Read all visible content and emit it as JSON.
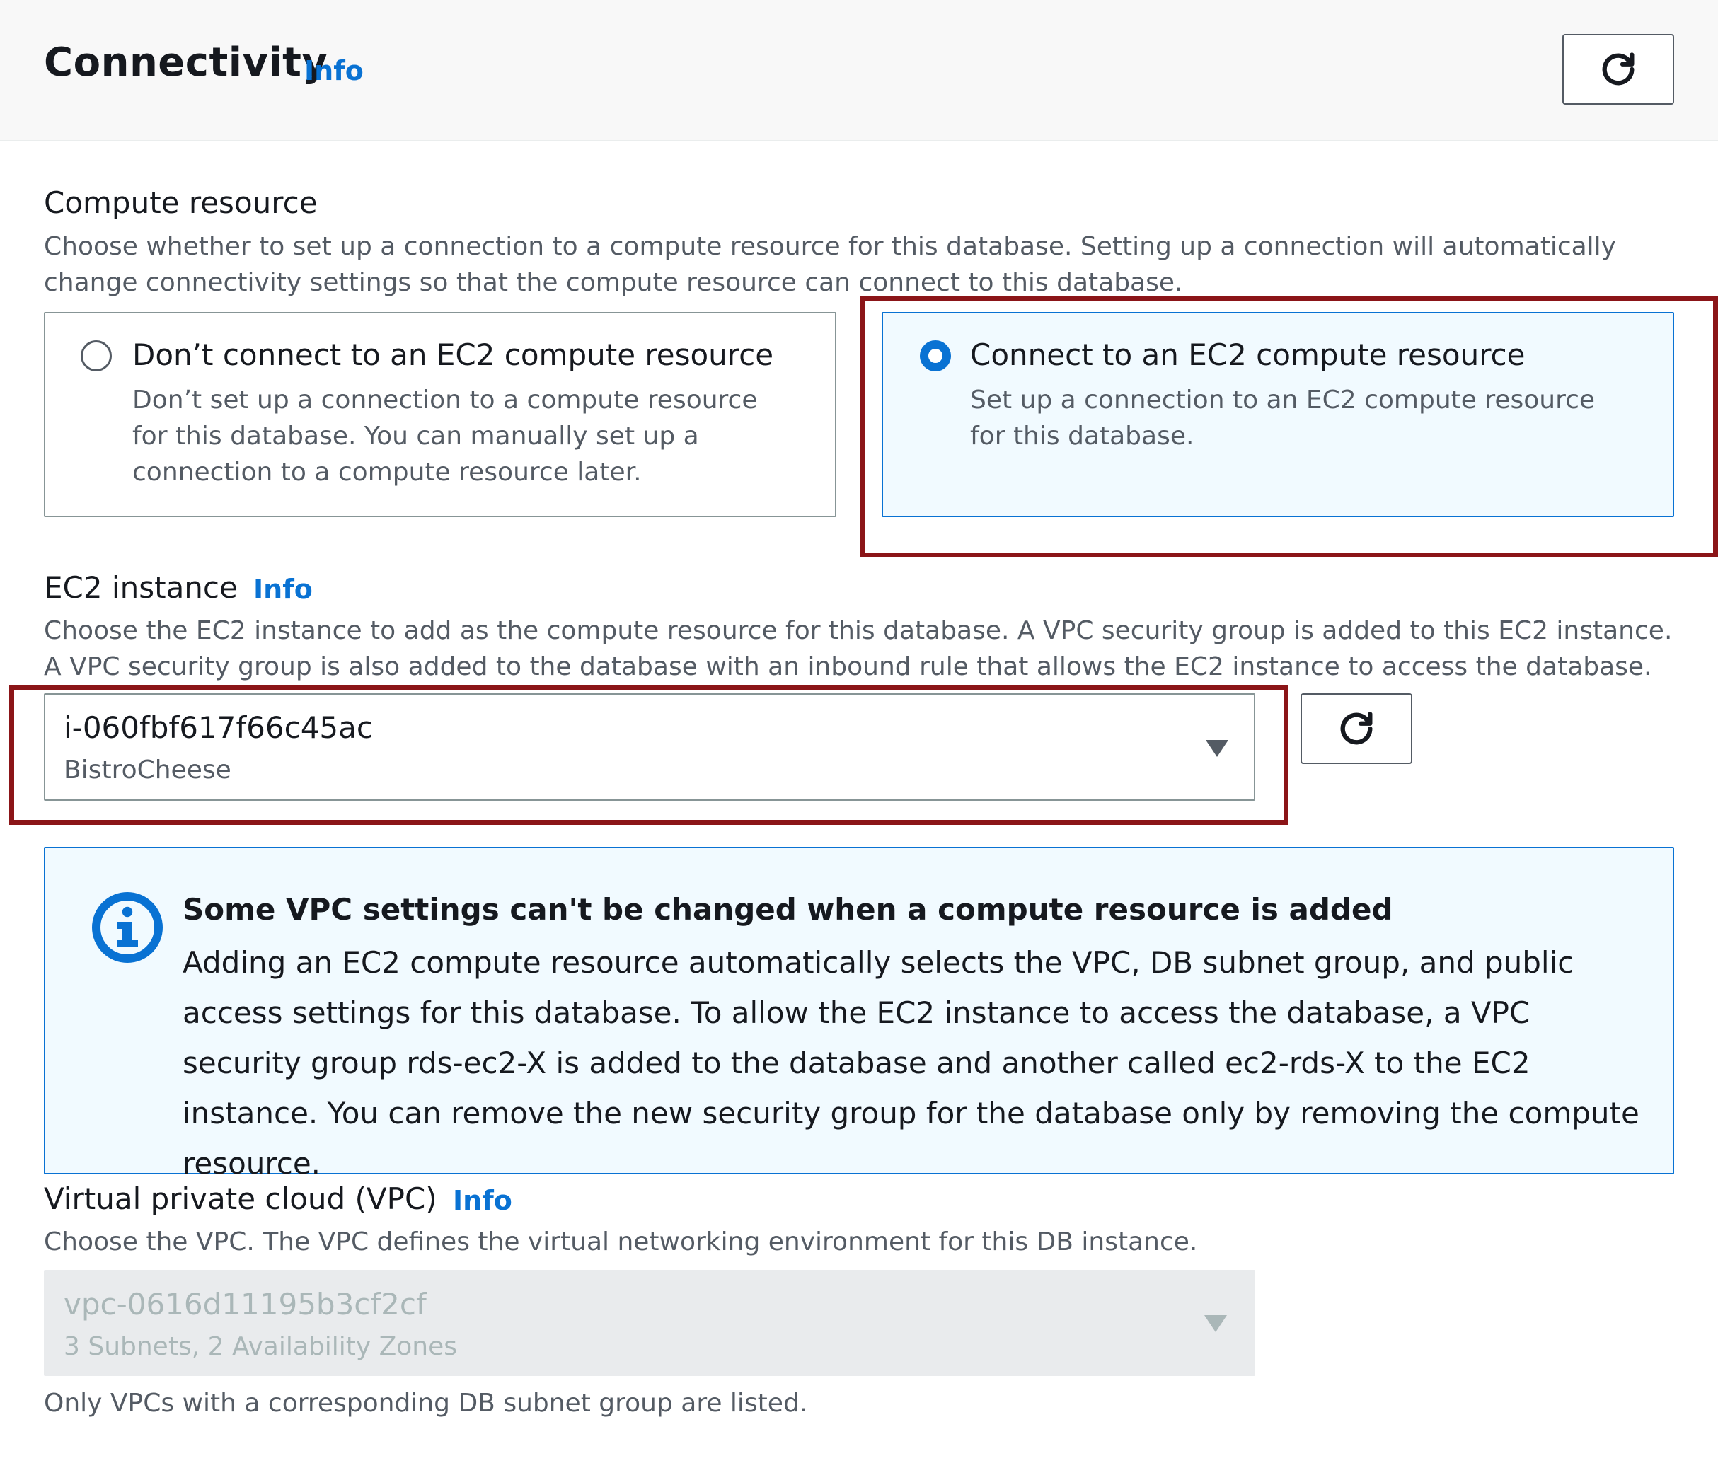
{
  "header": {
    "title": "Connectivity",
    "info": "Info"
  },
  "compute_resource": {
    "label": "Compute resource",
    "description": "Choose whether to set up a connection to a compute resource for this database. Setting up a connection will automatically change connectivity settings so that the compute resource can connect to this database.",
    "options": [
      {
        "title": "Don’t connect to an EC2 compute resource",
        "description": "Don’t set up a connection to a compute resource for this database. You can manually set up a connection to a compute resource later.",
        "selected": false
      },
      {
        "title": "Connect to an EC2 compute resource",
        "description": "Set up a connection to an EC2 compute resource for this database.",
        "selected": true
      }
    ]
  },
  "ec2_instance": {
    "label": "EC2 instance",
    "info": "Info",
    "description": "Choose the EC2 instance to add as the compute resource for this database. A VPC security group is added to this EC2 instance. A VPC security group is also added to the database with an inbound rule that allows the EC2 instance to access the database.",
    "selected_value": "i-060fbf617f66c45ac",
    "selected_subtext": "BistroCheese"
  },
  "alert": {
    "title": "Some VPC settings can't be changed when a compute resource is added",
    "body": "Adding an EC2 compute resource automatically selects the VPC, DB subnet group, and public access settings for this database. To allow the EC2 instance to access the database, a VPC security group rds-ec2-X is added to the database and another called ec2-rds-X to the EC2 instance. You can remove the new security group for the database only by removing the compute resource."
  },
  "vpc": {
    "label": "Virtual private cloud (VPC)",
    "info": "Info",
    "description": "Choose the VPC. The VPC defines the virtual networking environment for this DB instance.",
    "selected_value": "vpc-0616d11195b3cf2cf",
    "selected_subtext": "3 Subnets, 2 Availability Zones",
    "constraint": "Only VPCs with a corresponding DB subnet group are listed.",
    "disabled": true
  },
  "colors": {
    "accent": "#0972d3",
    "highlight": "#8b1518",
    "header_bg": "#f8f8f8",
    "alert_bg": "#f1faff",
    "disabled_bg": "#e9ebed"
  },
  "icons": [
    "refresh-icon",
    "caret-down-icon",
    "info-circle-icon"
  ]
}
